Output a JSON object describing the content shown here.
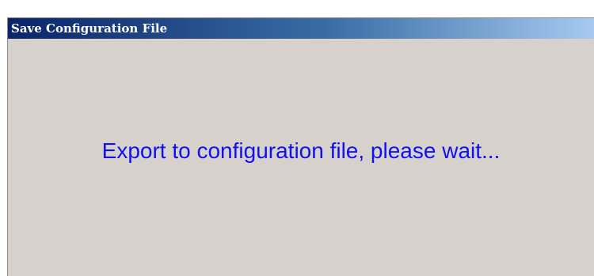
{
  "window": {
    "title": "Save Configuration File"
  },
  "content": {
    "message": "Export to configuration file, please wait..."
  },
  "colors": {
    "titlebar_start": "#0a246a",
    "titlebar_end": "#a6caf0",
    "panel_background": "#d6d2cb",
    "message_text": "#1010f0",
    "title_text": "#ffffff"
  }
}
